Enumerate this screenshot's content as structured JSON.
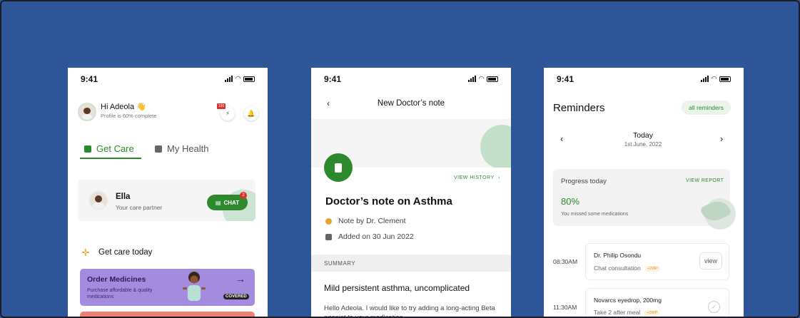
{
  "status": {
    "time": "9:41"
  },
  "screen1": {
    "greeting": "Hi Adeola 👋",
    "profile_progress": "Profile is 60% complete",
    "notif_badge": "100",
    "tabs": [
      {
        "label": "Get Care",
        "active": true
      },
      {
        "label": "My Health",
        "active": false
      }
    ],
    "partner": {
      "name": "Ella",
      "role": "Your care partner",
      "chat_label": "CHAT",
      "chat_badge": "2"
    },
    "section_title": "Get care today",
    "order_card": {
      "title": "Order Medicines",
      "subtitle": "Purchase affordable & quality medications",
      "badge": "COVERED"
    }
  },
  "screen2": {
    "header_title": "New Doctor’s note",
    "view_history": "VIEW HISTORY",
    "note_title": "Doctor’s note on Asthma",
    "note_by": "Note by Dr. Clement",
    "added_on": "Added on 30 Jun 2022",
    "summary_label": "SUMMARY",
    "diagnosis": "Mild persistent asthma, uncomplicated",
    "body_text": "Hello Adeola. I would like to try adding a long-acting Beta agonist to your medication"
  },
  "screen3": {
    "title": "Reminders",
    "all_reminders": "all reminders",
    "date_title": "Today",
    "date_sub": "1st June, 2022",
    "progress": {
      "label": "Progress today",
      "view_report": "VIEW REPORT",
      "value": "80%",
      "note": "You missed some medications"
    },
    "reminders": [
      {
        "time": "08:30AM",
        "title": "Dr. Philip Osondu",
        "sub": "Chat consultation",
        "tag": "+2WP",
        "action": "view"
      },
      {
        "time": "11:30AM",
        "title": "Novarcs eyedrop, 200mg",
        "sub": "Take 2 after meal",
        "tag": "+2WP",
        "action": "✓"
      }
    ]
  },
  "colors": {
    "background": "#2e5597",
    "accent": "#2c8a2c",
    "purple_card": "#a58be0",
    "red_card": "#ef7f77"
  }
}
